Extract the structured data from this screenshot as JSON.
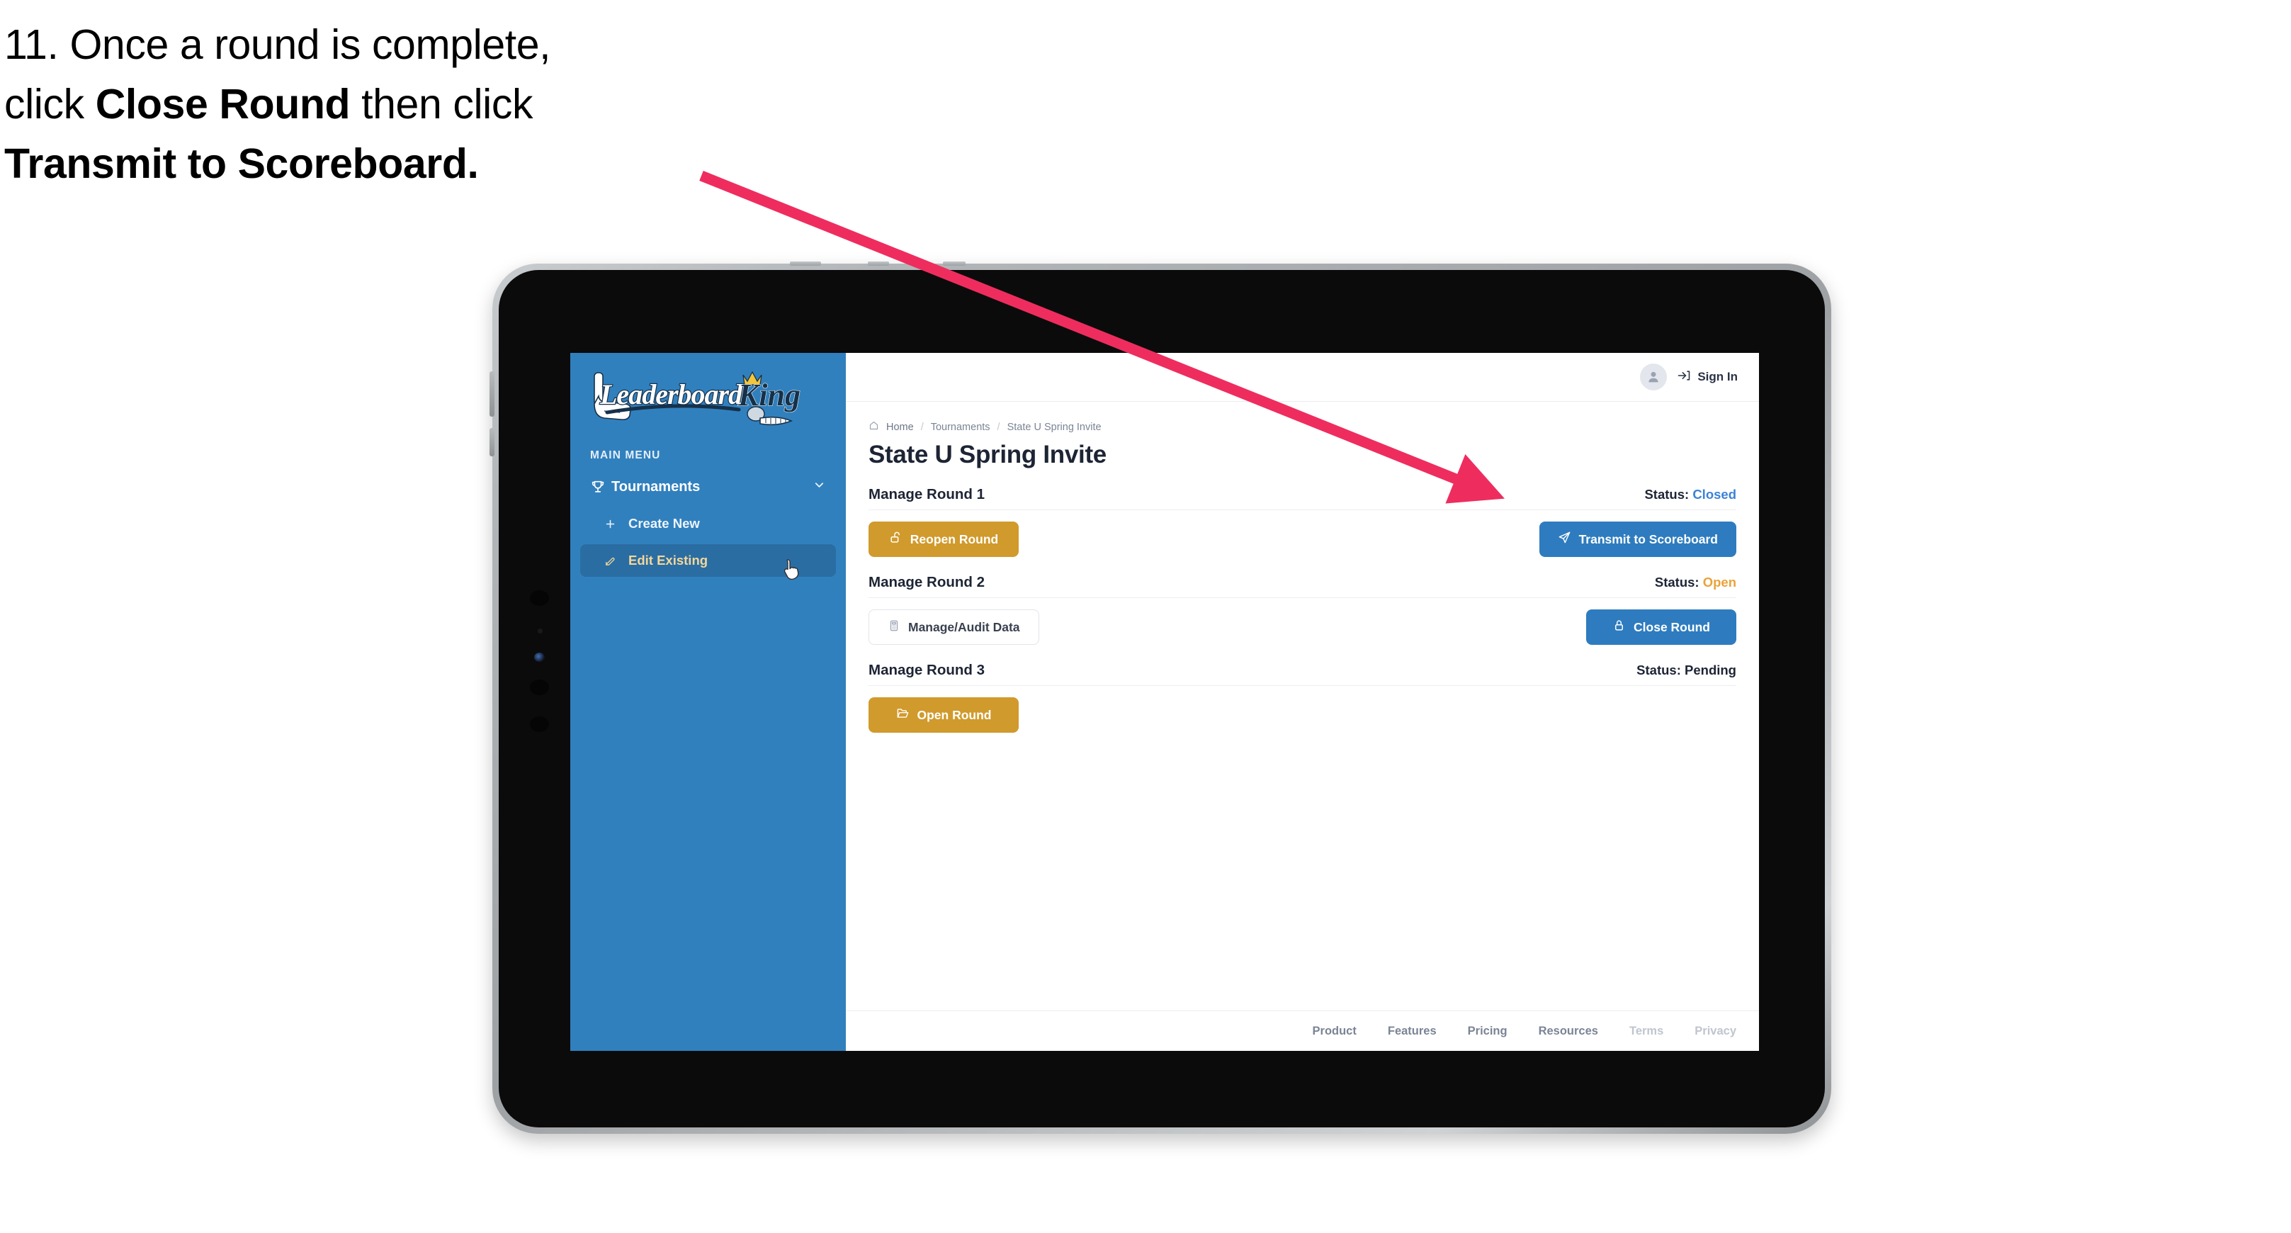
{
  "caption": {
    "line1_number": "11.",
    "line1_rest": " Once a round is complete,",
    "line2_pre": "click ",
    "line2_bold": "Close Round",
    "line2_post": " then click",
    "line3_bold": "Transmit to Scoreboard."
  },
  "annotation": {
    "arrow_color": "#ee2d5e"
  },
  "sidebar": {
    "logo_word_1": "Leaderboard",
    "logo_word_2": "King",
    "section_label": "MAIN MENU",
    "nav": {
      "label": "Tournaments",
      "icon": "trophy-icon",
      "chevron": "chevron-down-icon"
    },
    "items": [
      {
        "label": "Create New",
        "icon": "plus-icon",
        "active": false
      },
      {
        "label": "Edit Existing",
        "icon": "pencil-square-icon",
        "active": true
      }
    ],
    "bg_color": "#3180be",
    "active_bg_color": "#2a6da3",
    "active_text_color": "#f3d79a"
  },
  "topbar": {
    "avatar_icon": "user-avatar-icon",
    "signin_icon": "login-arrow-icon",
    "signin_label": "Sign In"
  },
  "breadcrumb": {
    "home_icon": "home-icon",
    "items": [
      "Home",
      "Tournaments",
      "State U Spring Invite"
    ],
    "separator": "/"
  },
  "page": {
    "title": "State U Spring Invite"
  },
  "rounds": [
    {
      "title": "Manage Round 1",
      "status_label": "Status:",
      "status_value": "Closed",
      "status_class": "val-closed",
      "left_button": {
        "label": "Reopen Round",
        "icon": "unlock-icon",
        "style": "btn-gold"
      },
      "right_button": {
        "label": "Transmit to Scoreboard",
        "icon": "paper-plane-icon",
        "style": "btn-blue"
      }
    },
    {
      "title": "Manage Round 2",
      "status_label": "Status:",
      "status_value": "Open",
      "status_class": "val-open",
      "left_button": {
        "label": "Manage/Audit Data",
        "icon": "calculator-icon",
        "style": "btn-ghost"
      },
      "right_button": {
        "label": "Close Round",
        "icon": "lock-icon",
        "style": "btn-blue"
      }
    },
    {
      "title": "Manage Round 3",
      "status_label": "Status:",
      "status_value": "Pending",
      "status_class": "val-pending",
      "left_button": {
        "label": "Open Round",
        "icon": "folder-open-icon",
        "style": "btn-gold"
      },
      "right_button": null
    }
  ],
  "footer": {
    "links": [
      {
        "label": "Product",
        "muted": false
      },
      {
        "label": "Features",
        "muted": false
      },
      {
        "label": "Pricing",
        "muted": false
      },
      {
        "label": "Resources",
        "muted": false
      },
      {
        "label": "Terms",
        "muted": true
      },
      {
        "label": "Privacy",
        "muted": true
      }
    ]
  },
  "colors": {
    "gold": "#d19a2c",
    "blue": "#2e7cbf",
    "sidebar_blue": "#3180be",
    "status_closed": "#3b82d6",
    "status_open": "#eaa23a",
    "arrow_pink": "#ee2d5e"
  }
}
